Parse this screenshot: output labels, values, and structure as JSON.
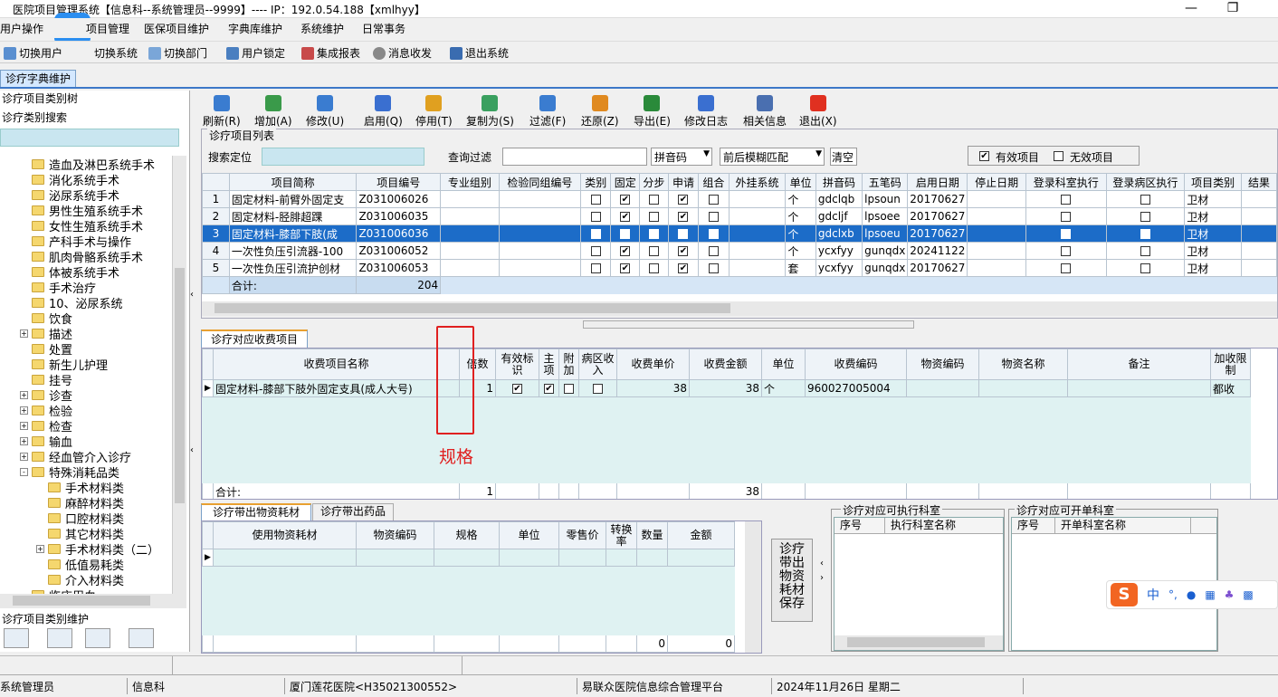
{
  "window": {
    "title": "医院项目管理系统【信息科--系统管理员--9999】---- IP：192.0.54.188【xmlhyy】"
  },
  "menu": [
    "用户操作",
    "项目管理",
    "医保项目维护",
    "字典库维护",
    "系统维护",
    "日常事务"
  ],
  "toolbar": [
    "切换用户",
    "切换系统",
    "切换部门",
    "用户锁定",
    "集成报表",
    "消息收发",
    "退出系统"
  ],
  "tab": "诊疗字典维护",
  "left": {
    "tree_title": "诊疗项目类别树",
    "search_label": "诊疗类别搜索",
    "tree": [
      {
        "label": "造血及淋巴系统手术",
        "level": 1
      },
      {
        "label": "消化系统手术",
        "level": 1
      },
      {
        "label": "泌尿系统手术",
        "level": 1
      },
      {
        "label": "男性生殖系统手术",
        "level": 1
      },
      {
        "label": "女性生殖系统手术",
        "level": 1
      },
      {
        "label": "产科手术与操作",
        "level": 1
      },
      {
        "label": "肌肉骨骼系统手术",
        "level": 1
      },
      {
        "label": "体被系统手术",
        "level": 1
      },
      {
        "label": "手术治疗",
        "level": 1
      },
      {
        "label": "10、泌尿系统",
        "level": 1
      },
      {
        "label": "饮食",
        "level": 1
      },
      {
        "label": "描述",
        "level": 1,
        "expander": "+"
      },
      {
        "label": "处置",
        "level": 1
      },
      {
        "label": "新生儿护理",
        "level": 1
      },
      {
        "label": "挂号",
        "level": 1
      },
      {
        "label": "诊查",
        "level": 1,
        "expander": "+"
      },
      {
        "label": "检验",
        "level": 1,
        "expander": "+"
      },
      {
        "label": "检查",
        "level": 1,
        "expander": "+"
      },
      {
        "label": "输血",
        "level": 1,
        "expander": "+"
      },
      {
        "label": "经血管介入诊疗",
        "level": 1,
        "expander": "+"
      },
      {
        "label": "特殊消耗品类",
        "level": 1,
        "expander": "-"
      },
      {
        "label": "手术材料类",
        "level": 2
      },
      {
        "label": "麻醉材料类",
        "level": 2
      },
      {
        "label": "口腔材料类",
        "level": 2
      },
      {
        "label": "其它材料类",
        "level": 2
      },
      {
        "label": "手术材料类（二）",
        "level": 2,
        "expander": "+"
      },
      {
        "label": "低值易耗类",
        "level": 2
      },
      {
        "label": "介入材料类",
        "level": 2
      },
      {
        "label": "临床用血",
        "level": 1
      }
    ],
    "maint_title": "诊疗项目类别维护"
  },
  "actions": [
    "刷新(R)",
    "增加(A)",
    "修改(U)",
    "启用(Q)",
    "停用(T)",
    "复制为(S)",
    "过滤(F)",
    "还原(Z)",
    "导出(E)",
    "修改日志",
    "相关信息",
    "退出(X)"
  ],
  "list": {
    "title": "诊疗项目列表",
    "search_label": "搜索定位",
    "filter_label": "查询过滤",
    "pinyin": "拼音码",
    "match": "前后模糊匹配",
    "clear": "清空",
    "valid": "有效项目",
    "invalid": "无效项目",
    "columns": [
      "项目简称",
      "项目编号",
      "专业组别",
      "检验同组编号",
      "类别",
      "固定",
      "分步",
      "申请",
      "组合",
      "外挂系统",
      "单位",
      "拼音码",
      "五笔码",
      "启用日期",
      "停止日期",
      "登录科室执行",
      "登录病区执行",
      "项目类别",
      "结果"
    ],
    "rows": [
      {
        "n": "1",
        "name": "固定材料-前臂外固定支",
        "code": "Z031006026",
        "fixed": true,
        "apply": true,
        "unit": "个",
        "py": "gdclqb",
        "wb": "lpsoun",
        "start": "20170627",
        "cat": "卫材"
      },
      {
        "n": "2",
        "name": "固定材料-胫腓超踝",
        "code": "Z031006035",
        "fixed": true,
        "apply": true,
        "unit": "个",
        "py": "gdcljf",
        "wb": "lpsoee",
        "start": "20170627",
        "cat": "卫材"
      },
      {
        "n": "3",
        "name": "固定材料-膝部下肢(成",
        "code": "Z031006036",
        "fixed": true,
        "apply": true,
        "unit": "个",
        "py": "gdclxb",
        "wb": "lpsoeu",
        "start": "20170627",
        "cat": "卫材",
        "selected": true
      },
      {
        "n": "4",
        "name": "一次性负压引流器-100",
        "code": "Z031006052",
        "fixed": true,
        "apply": true,
        "unit": "个",
        "py": "ycxfyy",
        "wb": "gunqdx",
        "start": "20241122",
        "cat": "卫材"
      },
      {
        "n": "5",
        "name": "一次性负压引流护创材",
        "code": "Z031006053",
        "fixed": true,
        "apply": true,
        "unit": "套",
        "py": "ycxfyy",
        "wb": "gunqdx",
        "start": "20170627",
        "cat": "卫材"
      }
    ],
    "total_label": "合计:",
    "total": "204"
  },
  "fee": {
    "tab": "诊疗对应收费项目",
    "columns": [
      "收费项目名称",
      "倍数",
      "有效标识",
      "主项",
      "附加",
      "病区收入",
      "收费单价",
      "收费金额",
      "单位",
      "收费编码",
      "物资编码",
      "物资名称",
      "备注",
      "加收限制"
    ],
    "rows": [
      {
        "name": "固定材料-膝部下肢外固定支具(成人大号)",
        "mult": "1",
        "valid": true,
        "main": true,
        "extra": false,
        "ward": false,
        "price": "38",
        "amount": "38",
        "unit": "个",
        "code": "960027005004",
        "extra_limit": "都收"
      }
    ],
    "total_label": "合计:",
    "total_mult": "1",
    "total_amount": "38",
    "annotation": "规格",
    "annotation_color": "#e02020"
  },
  "material": {
    "tabs": [
      "诊疗带出物资耗材",
      "诊疗带出药品"
    ],
    "columns": [
      "使用物资耗材",
      "物资编码",
      "规格",
      "单位",
      "零售价",
      "转换率",
      "数量",
      "金额"
    ],
    "totals": [
      "0",
      "0"
    ],
    "save_button": "诊疗带出物资耗材保存"
  },
  "exec_dept": {
    "title": "诊疗对应可执行科室",
    "columns": [
      "序号",
      "执行科室名称"
    ]
  },
  "order_dept": {
    "title": "诊疗对应可开单科室",
    "columns": [
      "序号",
      "开单科室名称"
    ]
  },
  "ime": [
    "中",
    "°,",
    "🎤",
    "⌨",
    "👕",
    "▦"
  ],
  "status": [
    "系统管理员",
    "信息科",
    "厦门莲花医院<H35021300552>",
    "易联众医院信息综合管理平台",
    "2024年11月26日 星期二"
  ]
}
